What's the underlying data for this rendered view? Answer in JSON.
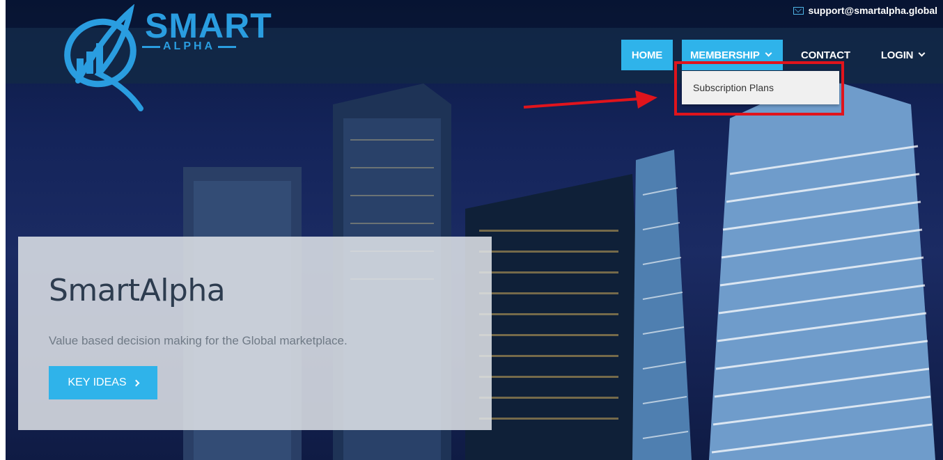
{
  "topbar": {
    "email": "support@smartalpha.global",
    "email_icon": "mail-icon"
  },
  "brand": {
    "name": "SMART",
    "tagline": "ALPHA"
  },
  "nav": {
    "home": "HOME",
    "membership": "MEMBERSHIP",
    "contact": "CONTACT",
    "login": "LOGIN"
  },
  "dropdown": {
    "items": [
      "Subscription Plans"
    ]
  },
  "hero": {
    "title": "SmartAlpha",
    "subtitle": "Value based decision making for the Global marketplace.",
    "button": "KEY IDEAS"
  },
  "colors": {
    "accent": "#2fb3ea",
    "brand_blue": "#2a9de0",
    "annotation_red": "#e0141c",
    "header": "#122a46"
  }
}
